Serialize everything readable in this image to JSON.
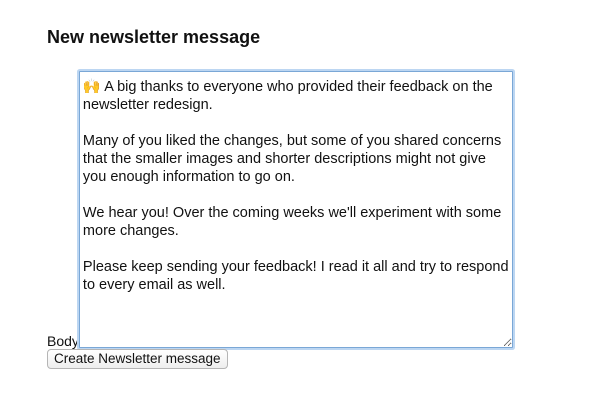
{
  "form": {
    "title": "New newsletter message",
    "body_label": "Body",
    "body_value": "🙌 A big thanks to everyone who provided their feedback on the newsletter redesign.\n\nMany of you liked the changes, but some of you shared concerns that the smaller images and shorter descriptions might not give you enough information to go on.\n\nWe hear you! Over the coming weeks we'll experiment with some more changes.\n\nPlease keep sending your feedback! I read it all and try to respond to every email as well.",
    "submit_label": "Create Newsletter message"
  },
  "colors": {
    "focus_ring": "#bcd6f2",
    "focus_border": "#7aa7d6"
  }
}
